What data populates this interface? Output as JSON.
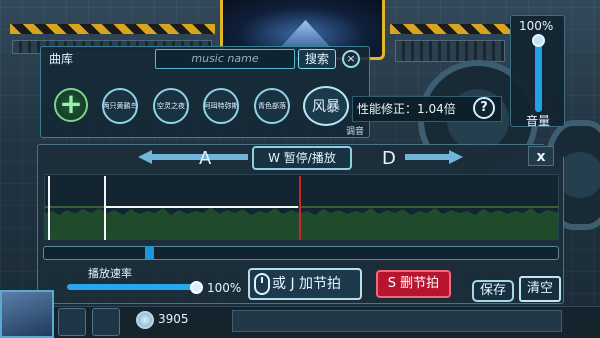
{
  "library": {
    "title": "曲库",
    "search_placeholder": "music name",
    "search_label": "搜索",
    "close_symbol": "×",
    "add_symbol": "+",
    "songs": [
      "两只黄鹂鸟",
      "空灵之夜",
      "阿珥特弥斯",
      "青色部落",
      "风暴"
    ]
  },
  "performance": {
    "label": "性能修正：1.04倍",
    "help_symbol": "?",
    "tune_label": "调音"
  },
  "volume": {
    "percent": "100%",
    "label": "音量",
    "level": 1.0
  },
  "editor": {
    "left_key": "A",
    "right_key": "D",
    "pause_label": "W  暂停/播放",
    "close_label": "x",
    "speed_label": "播放速率",
    "speed_percent": "100%",
    "add_beat_label": "或 J 加节拍",
    "delete_beat_label": "S 删节拍",
    "save_label": "保存",
    "clear_label": "清空"
  },
  "footer": {
    "currency": "3905"
  },
  "colors": {
    "accent": "#1fa3e6",
    "playhead": "#d32222",
    "delete": "#b7142e",
    "add": "#7bd68a",
    "warning_stripe": "#d9a521"
  }
}
